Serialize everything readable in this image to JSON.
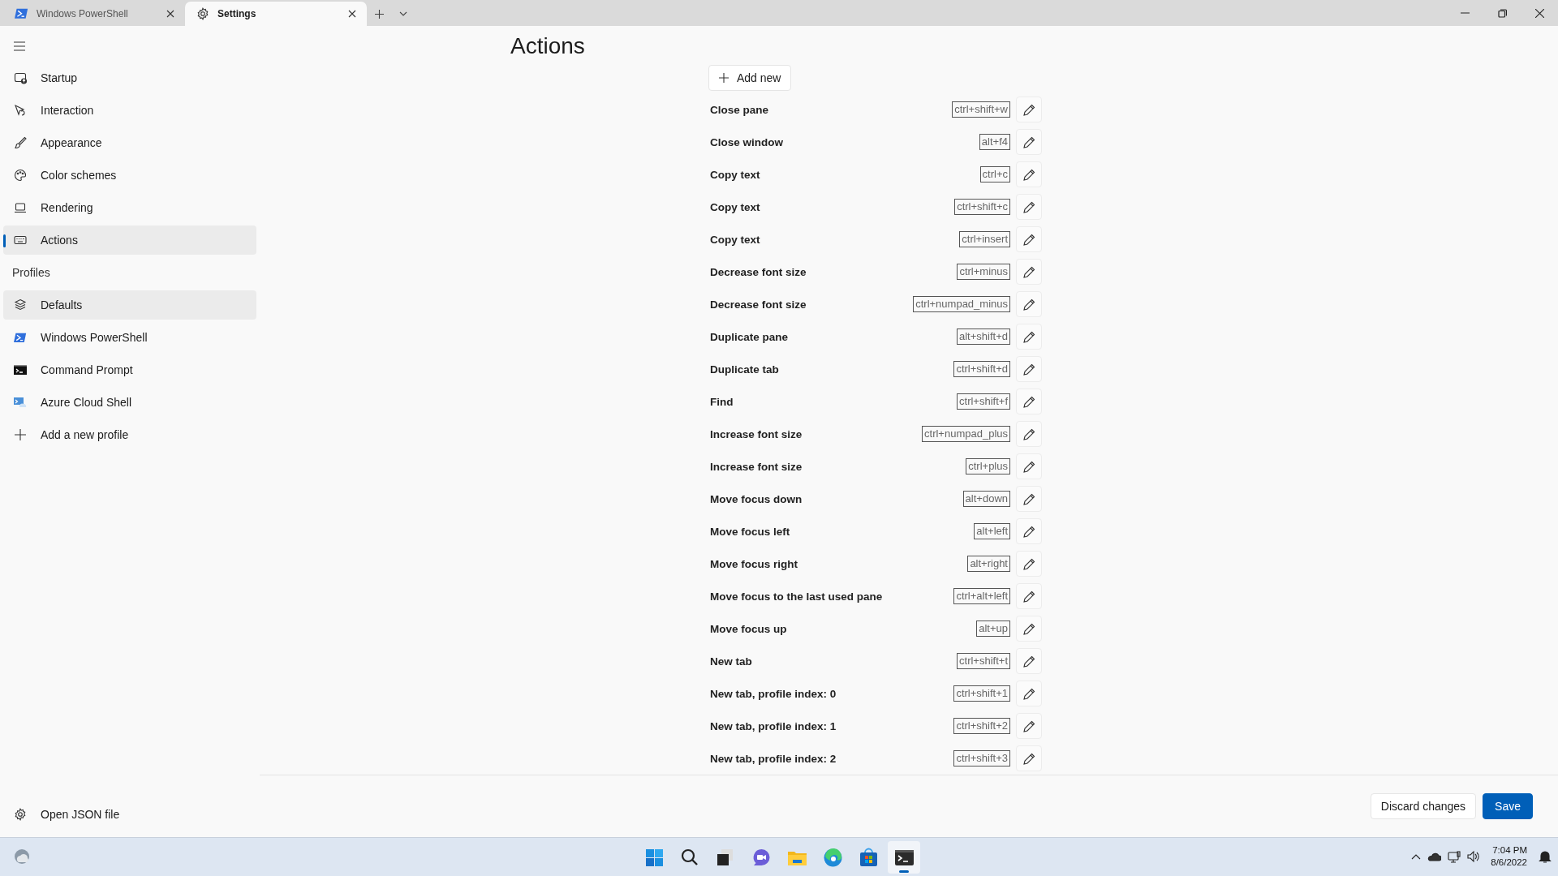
{
  "tabs": [
    {
      "label": "Windows PowerShell",
      "selected": false
    },
    {
      "label": "Settings",
      "selected": true
    }
  ],
  "sidebar": {
    "items": [
      {
        "label": "Startup",
        "selected": false,
        "hovered": false
      },
      {
        "label": "Interaction",
        "selected": false,
        "hovered": false
      },
      {
        "label": "Appearance",
        "selected": false,
        "hovered": false
      },
      {
        "label": "Color schemes",
        "selected": false,
        "hovered": false
      },
      {
        "label": "Rendering",
        "selected": false,
        "hovered": false
      },
      {
        "label": "Actions",
        "selected": true,
        "hovered": false
      }
    ],
    "section_header": "Profiles",
    "profiles": [
      {
        "label": "Defaults",
        "selected": false,
        "hovered": true
      },
      {
        "label": "Windows PowerShell",
        "selected": false,
        "hovered": false
      },
      {
        "label": "Command Prompt",
        "selected": false,
        "hovered": false
      },
      {
        "label": "Azure Cloud Shell",
        "selected": false,
        "hovered": false
      },
      {
        "label": "Add a new profile",
        "selected": false,
        "hovered": false
      }
    ],
    "footer": "Open JSON file"
  },
  "page_title": "Actions",
  "add_button": "Add new",
  "actions": [
    {
      "name": "Close pane",
      "keys": "ctrl+shift+w"
    },
    {
      "name": "Close window",
      "keys": "alt+f4"
    },
    {
      "name": "Copy text",
      "keys": "ctrl+c"
    },
    {
      "name": "Copy text",
      "keys": "ctrl+shift+c"
    },
    {
      "name": "Copy text",
      "keys": "ctrl+insert"
    },
    {
      "name": "Decrease font size",
      "keys": "ctrl+minus"
    },
    {
      "name": "Decrease font size",
      "keys": "ctrl+numpad_minus"
    },
    {
      "name": "Duplicate pane",
      "keys": "alt+shift+d"
    },
    {
      "name": "Duplicate tab",
      "keys": "ctrl+shift+d"
    },
    {
      "name": "Find",
      "keys": "ctrl+shift+f"
    },
    {
      "name": "Increase font size",
      "keys": "ctrl+numpad_plus"
    },
    {
      "name": "Increase font size",
      "keys": "ctrl+plus"
    },
    {
      "name": "Move focus down",
      "keys": "alt+down"
    },
    {
      "name": "Move focus left",
      "keys": "alt+left"
    },
    {
      "name": "Move focus right",
      "keys": "alt+right"
    },
    {
      "name": "Move focus to the last used pane",
      "keys": "ctrl+alt+left"
    },
    {
      "name": "Move focus up",
      "keys": "alt+up"
    },
    {
      "name": "New tab",
      "keys": "ctrl+shift+t"
    },
    {
      "name": "New tab, profile index: 0",
      "keys": "ctrl+shift+1"
    },
    {
      "name": "New tab, profile index: 1",
      "keys": "ctrl+shift+2"
    },
    {
      "name": "New tab, profile index: 2",
      "keys": "ctrl+shift+3"
    }
  ],
  "buttons": [
    {
      "label": "Discard changes",
      "kind": "secondary"
    },
    {
      "label": "Save",
      "kind": "primary"
    }
  ],
  "taskbar": {
    "apps": [
      {
        "selected": false
      },
      {
        "selected": false
      },
      {
        "selected": false
      },
      {
        "selected": false
      },
      {
        "selected": false
      },
      {
        "selected": false
      },
      {
        "selected": false
      },
      {
        "selected": true
      }
    ],
    "time": "7:04 PM",
    "date": "8/6/2022"
  }
}
